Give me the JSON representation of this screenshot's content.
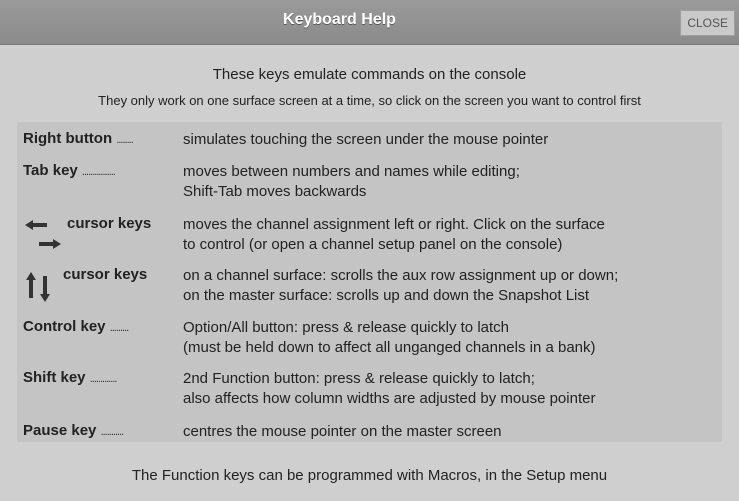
{
  "dialog": {
    "title": "Keyboard Help",
    "close_label": "CLOSE"
  },
  "intro": {
    "line1": "These keys emulate commands on the console",
    "line2": "They only work on one surface screen at a time, so click on the screen you want to control first"
  },
  "rows": [
    {
      "key": "Right button",
      "dots": "........",
      "desc1": "simulates touching the screen under the mouse pointer",
      "desc2": ""
    },
    {
      "key": "Tab key",
      "dots": "................",
      "desc1": "moves between numbers and names while editing;",
      "desc2": "Shift-Tab moves backwards"
    },
    {
      "key": "cursor keys",
      "dots": "",
      "icon": "left-right-arrows",
      "desc1": "moves the channel assignment left or right.  Click on the surface",
      "desc2": "to control (or open a channel setup panel on the console)"
    },
    {
      "key": "cursor keys",
      "dots": "",
      "icon": "up-down-arrows",
      "desc1": "on a channel surface: scrolls the aux row assignment up or down;",
      "desc2": "on the master surface: scrolls up and down the Snapshot List"
    },
    {
      "key": "Control key",
      "dots": ".........",
      "desc1": "Option/All button: press & release quickly to latch",
      "desc2": "(must be held down to affect all unganged channels in a bank)"
    },
    {
      "key": "Shift key",
      "dots": ".............",
      "desc1": "2nd Function button: press & release quickly to latch;",
      "desc2": "also affects how column widths are adjusted by mouse pointer"
    },
    {
      "key": "Pause key",
      "dots": "...........",
      "desc1": "centres the mouse pointer on the master screen",
      "desc2": ""
    }
  ],
  "footer": "The Function keys can be programmed with Macros, in the Setup menu"
}
